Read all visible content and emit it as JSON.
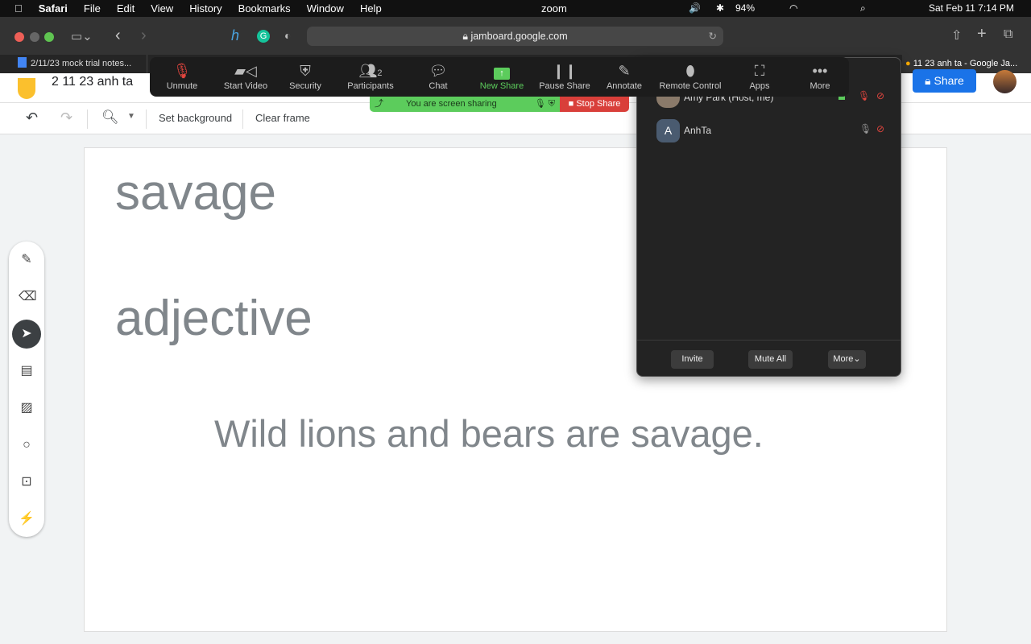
{
  "menubar": {
    "apple": "",
    "app": "Safari",
    "items": [
      "File",
      "Edit",
      "View",
      "History",
      "Bookmarks",
      "Window",
      "Help"
    ],
    "zoom": "zoom",
    "battery": "94%",
    "datetime": "Sat Feb 11  7:14 PM"
  },
  "safari": {
    "url": "jamboard.google.com"
  },
  "tabs": [
    {
      "label": "2/11/23 mock trial notes..."
    },
    {
      "label": "11 23 anh ta - Google Ja..."
    }
  ],
  "jamboard": {
    "title": "2 11 23 anh ta",
    "share": "Share",
    "toolbar": {
      "set_background": "Set background",
      "clear_frame": "Clear frame"
    },
    "canvas": {
      "word": "savage",
      "part_of_speech": "adjective",
      "sentence": "Wild lions and bears are savage."
    }
  },
  "zoom": {
    "toolbar": [
      {
        "label": "Unmute",
        "icon": "mic-off-icon"
      },
      {
        "label": "Start Video",
        "icon": "video-off-icon"
      },
      {
        "label": "Security",
        "icon": "shield-icon"
      },
      {
        "label": "Participants",
        "icon": "people-icon",
        "count": "2"
      },
      {
        "label": "Chat",
        "icon": "chat-icon"
      },
      {
        "label": "New Share",
        "icon": "share-up-icon"
      },
      {
        "label": "Pause Share",
        "icon": "pause-icon"
      },
      {
        "label": "Annotate",
        "icon": "pencil-icon"
      },
      {
        "label": "Remote Control",
        "icon": "mouse-icon"
      },
      {
        "label": "Apps",
        "icon": "apps-icon"
      },
      {
        "label": "More",
        "icon": "ellipsis-icon"
      }
    ],
    "sharing_text": "You are screen sharing",
    "stop_share": "Stop Share",
    "participants": [
      {
        "name": "Amy Park (Host, me)"
      },
      {
        "name": "AnhTa",
        "initial": "A"
      }
    ],
    "panel_buttons": {
      "invite": "Invite",
      "mute_all": "Mute All",
      "more": "More"
    }
  },
  "colors": {
    "jam_blue": "#1a73e8",
    "zoom_green": "#5ccc5c",
    "stop_red": "#d93f3a",
    "muted_red": "#e0453e"
  }
}
